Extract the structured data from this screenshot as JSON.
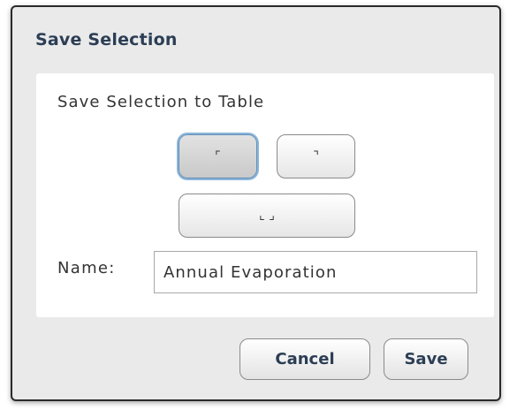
{
  "dialog": {
    "title": "Save Selection"
  },
  "panel": {
    "heading": "Save Selection to Table",
    "corner_buttons": {
      "top_left": {
        "glyph": "⌜",
        "selected": true
      },
      "top_right": {
        "glyph": "⌝",
        "selected": false
      },
      "bottom": {
        "glyph": "⌞ ⌟",
        "selected": false
      }
    },
    "name_label": "Name:",
    "name_value": "Annual Evaporation"
  },
  "footer": {
    "cancel_label": "Cancel",
    "save_label": "Save"
  },
  "colors": {
    "title_text": "#2c3e55",
    "selected_outline": "#8cb6d9",
    "dialog_background": "#eaeaea"
  }
}
